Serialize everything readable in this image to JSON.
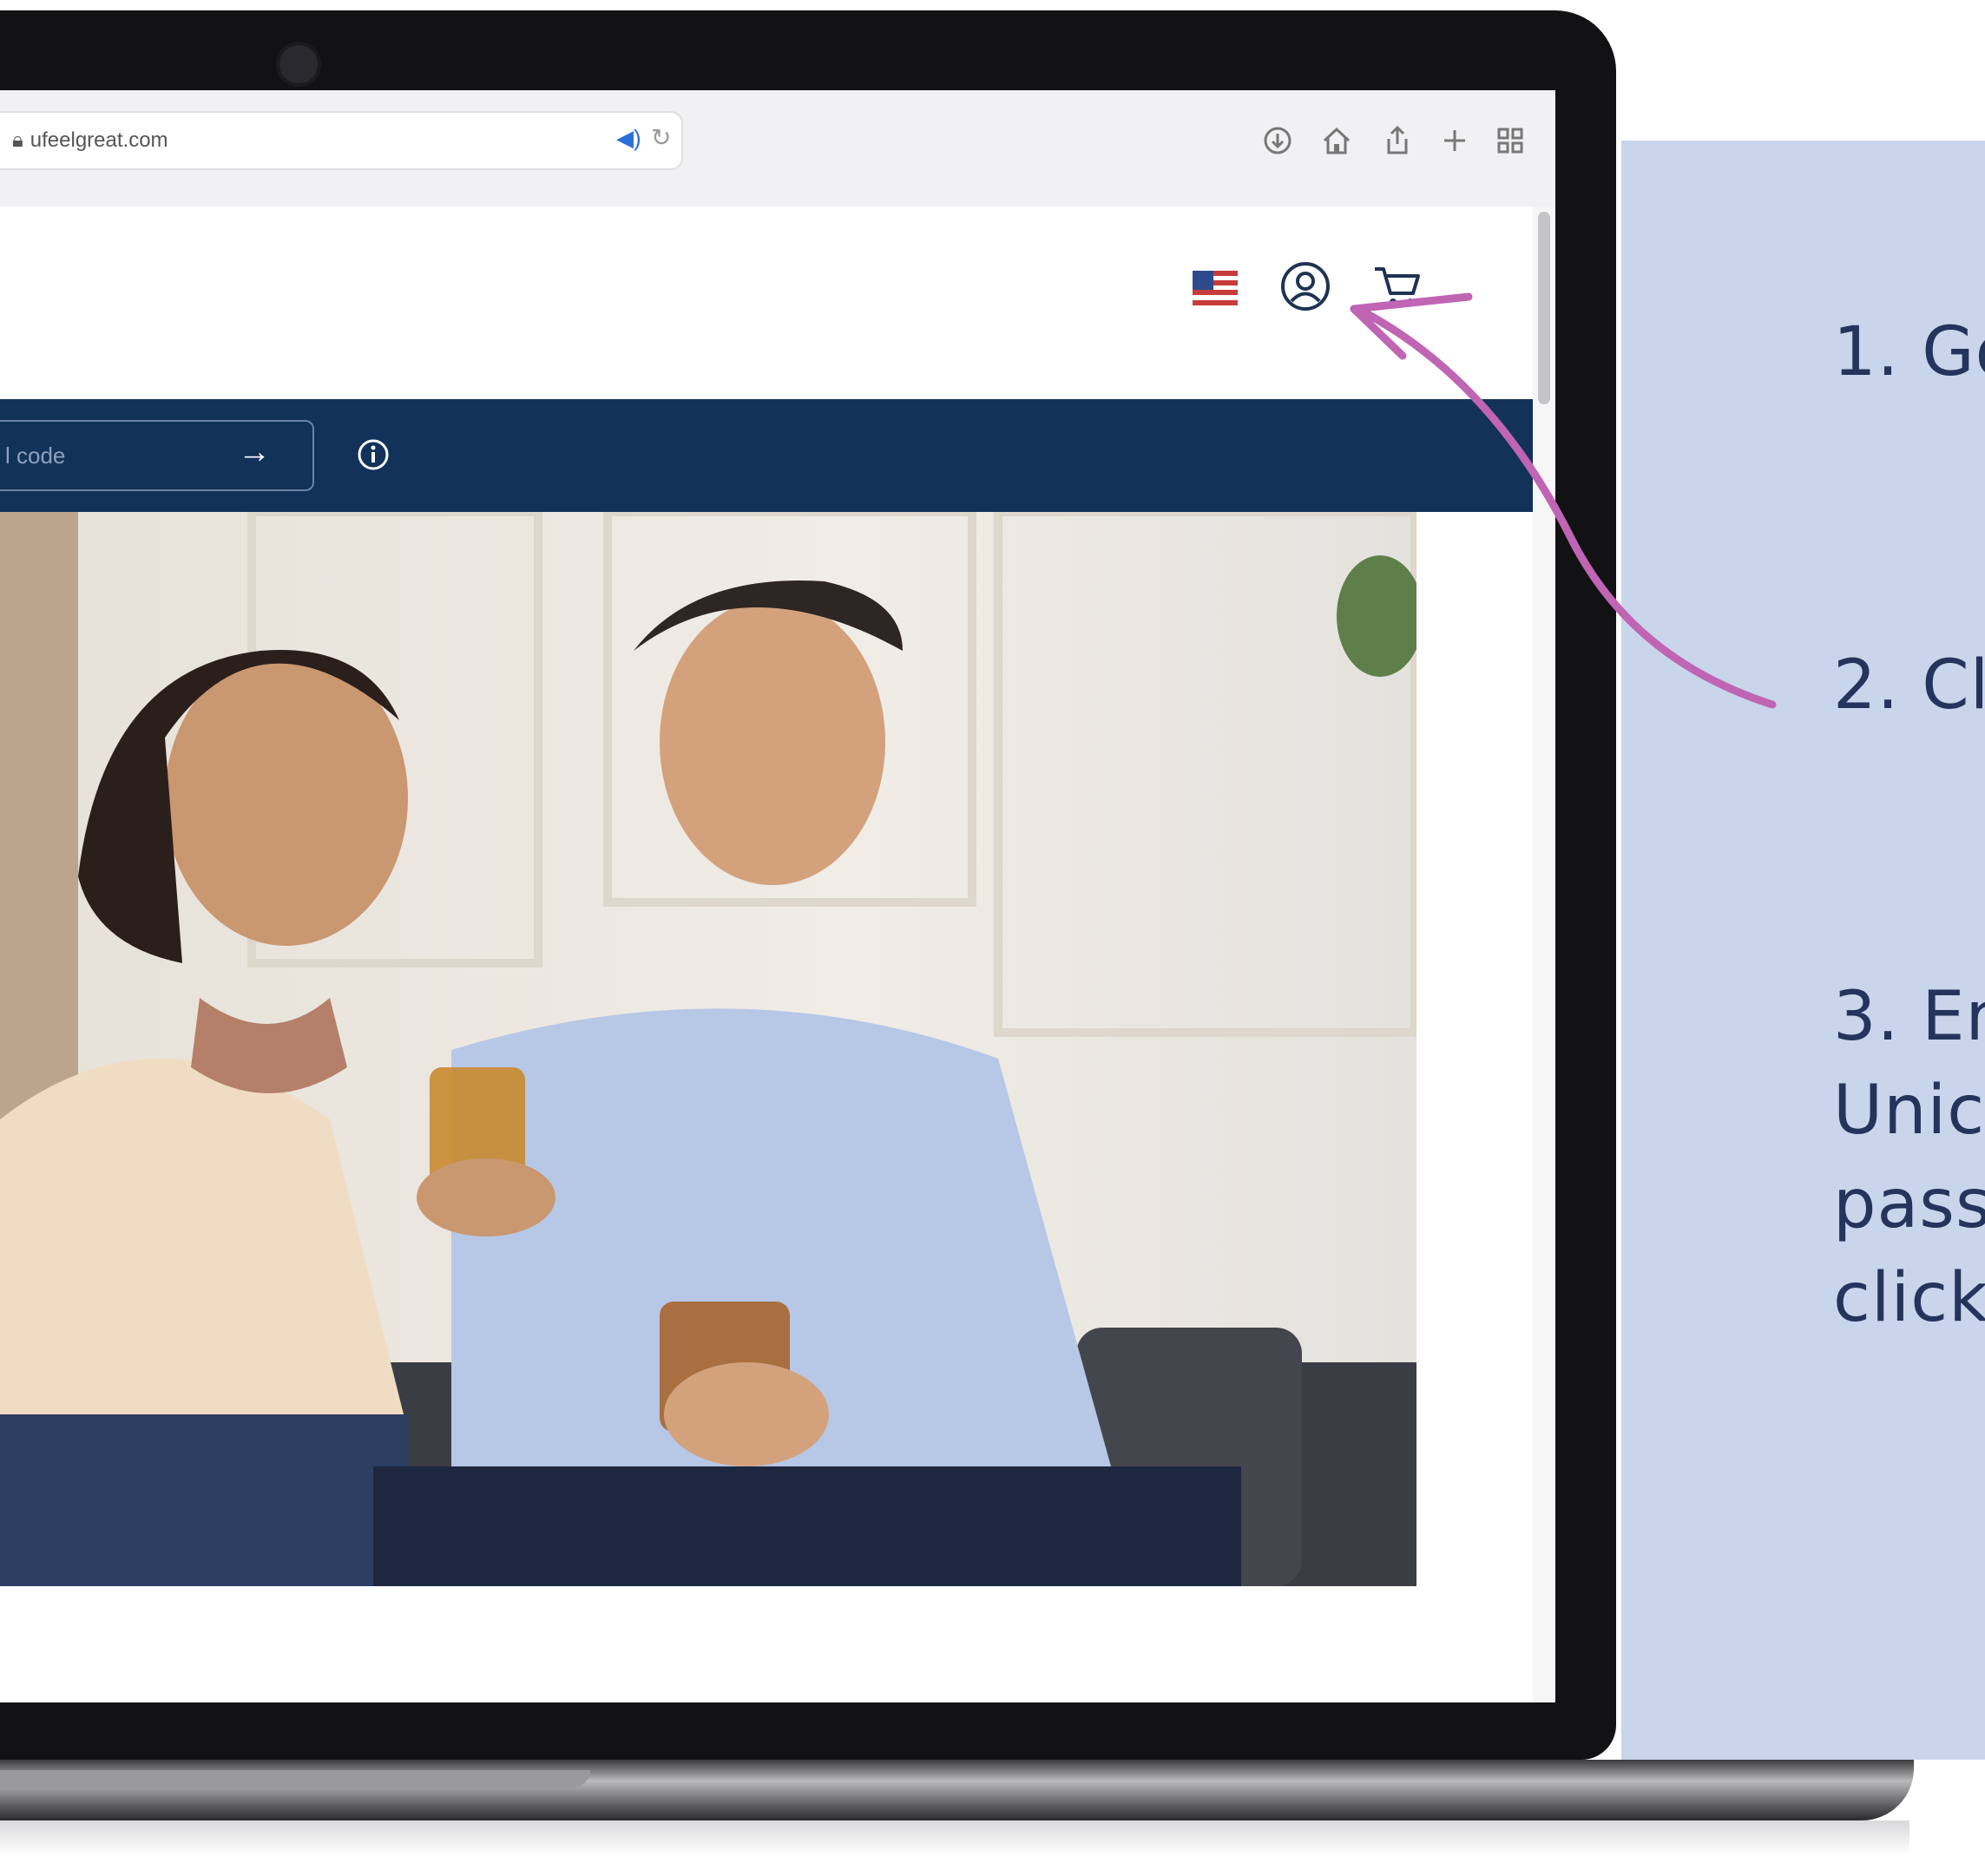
{
  "browser": {
    "url": "ufeelgreat.com",
    "toolbar_icons": [
      "download-icon",
      "home-icon",
      "share-icon",
      "new-tab-icon",
      "tab-overview-icon"
    ]
  },
  "site_header": {
    "icons": [
      "us-flag-icon",
      "account-icon",
      "cart-icon"
    ]
  },
  "promo_bar": {
    "referral_placeholder": "l code",
    "submit_arrow": "→",
    "info_icon": "info-icon"
  },
  "annotation": {
    "arrow_color": "#c064b4",
    "points_to": "account-icon"
  },
  "instructions": {
    "step1": "1. Go",
    "step2": "2. Cl",
    "step3_line1": "3. En",
    "step3_line2": "Unic",
    "step3_line3": "pass",
    "step3_line4": "click"
  },
  "colors": {
    "panel_bg": "#c9d5ea",
    "panel_text": "#24345c",
    "promo_bar": "#13325a"
  }
}
